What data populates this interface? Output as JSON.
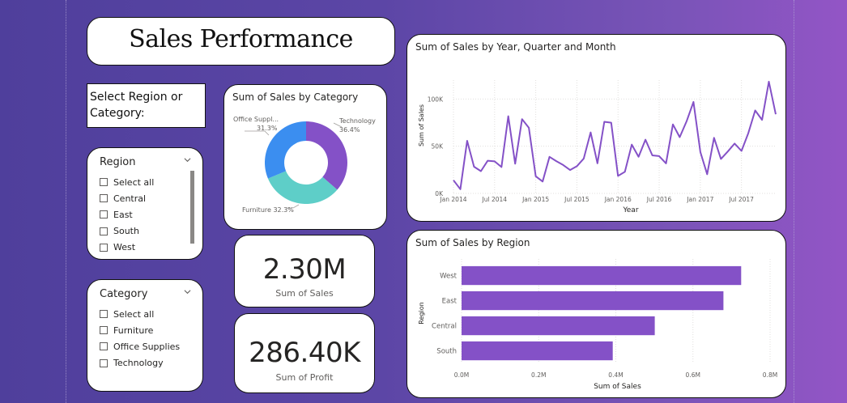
{
  "title": "Sales Performance",
  "select_prompt": "Select Region or Category:",
  "region_slicer": {
    "title": "Region",
    "items": [
      "Select all",
      "Central",
      "East",
      "South",
      "West"
    ]
  },
  "category_slicer": {
    "title": "Category",
    "items": [
      "Select all",
      "Furniture",
      "Office Supplies",
      "Technology"
    ]
  },
  "donut": {
    "title": "Sum of Sales by Category",
    "labels": {
      "office_name": "Office Suppl...",
      "office_pct": "31.3%",
      "tech_name": "Technology",
      "tech_pct": "36.4%",
      "furniture": "Furniture 32.3%"
    }
  },
  "kpi_sales": {
    "value": "2.30M",
    "label": "Sum of Sales"
  },
  "kpi_profit": {
    "value": "286.40K",
    "label": "Sum of Profit"
  },
  "colors": {
    "technology": "#8451c7",
    "furniture": "#5ecec8",
    "office_supplies": "#3b8ef0",
    "bar": "#8451c7",
    "line": "#8451c7"
  },
  "chart_data": [
    {
      "type": "line",
      "title": "Sum of Sales by Year, Quarter and Month",
      "xlabel": "Year",
      "ylabel": "Sum of Sales",
      "ylim": [
        0,
        120000
      ],
      "yticks": [
        0,
        50000,
        100000
      ],
      "ytick_labels": [
        "0K",
        "50K",
        "100K"
      ],
      "xtick_labels": [
        "Jan 2014",
        "Jul 2014",
        "Jan 2015",
        "Jul 2015",
        "Jan 2016",
        "Jul 2016",
        "Jan 2017",
        "Jul 2017"
      ],
      "series": [
        {
          "values": [
            14000,
            4500,
            55700,
            28300,
            23600,
            34600,
            33900,
            27900,
            81800,
            31500,
            78600,
            69500,
            18200,
            12600,
            38700,
            34200,
            30100,
            24800,
            28800,
            36900,
            64600,
            31900,
            75900,
            74900,
            18500,
            22900,
            51700,
            38800,
            56900,
            40300,
            39500,
            31800,
            73100,
            59600,
            76400,
            96900,
            43900,
            20300,
            58900,
            36500,
            44300,
            52800,
            45000,
            63800,
            87900,
            77900,
            118400,
            83800
          ]
        }
      ],
      "grid": true
    },
    {
      "type": "bar",
      "orientation": "horizontal",
      "title": "Sum of Sales by Region",
      "xlabel": "Sum of Sales",
      "ylabel": "Region",
      "categories": [
        "West",
        "East",
        "Central",
        "South"
      ],
      "values": [
        725000,
        679000,
        501000,
        392000
      ],
      "xlim": [
        0,
        800000
      ],
      "xticks": [
        0,
        200000,
        400000,
        600000,
        800000
      ],
      "xtick_labels": [
        "0.0M",
        "0.2M",
        "0.4M",
        "0.6M",
        "0.8M"
      ],
      "grid": true
    },
    {
      "type": "pie",
      "variant": "donut",
      "title": "Sum of Sales by Category",
      "categories": [
        "Technology",
        "Furniture",
        "Office Supplies"
      ],
      "values": [
        36.4,
        32.3,
        31.3
      ]
    }
  ]
}
